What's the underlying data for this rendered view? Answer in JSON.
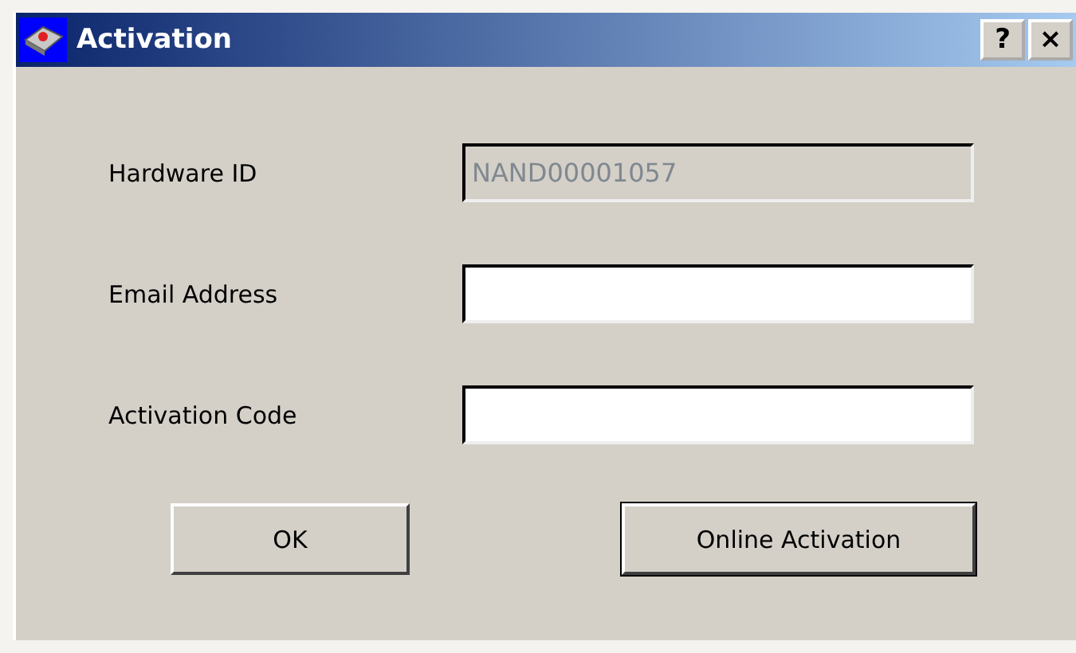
{
  "window": {
    "title": "Activation",
    "title_buttons": [
      "?",
      "×"
    ]
  },
  "fields": [
    {
      "label": "Hardware ID",
      "value": "NAND00001057",
      "disabled": true
    },
    {
      "label": "Email Address",
      "disabled": false
    },
    {
      "label": "Activation Code",
      "disabled": false
    }
  ],
  "buttons": [
    {
      "label": "OK",
      "default": false
    },
    {
      "label": "Online Activation",
      "default": true
    }
  ]
}
